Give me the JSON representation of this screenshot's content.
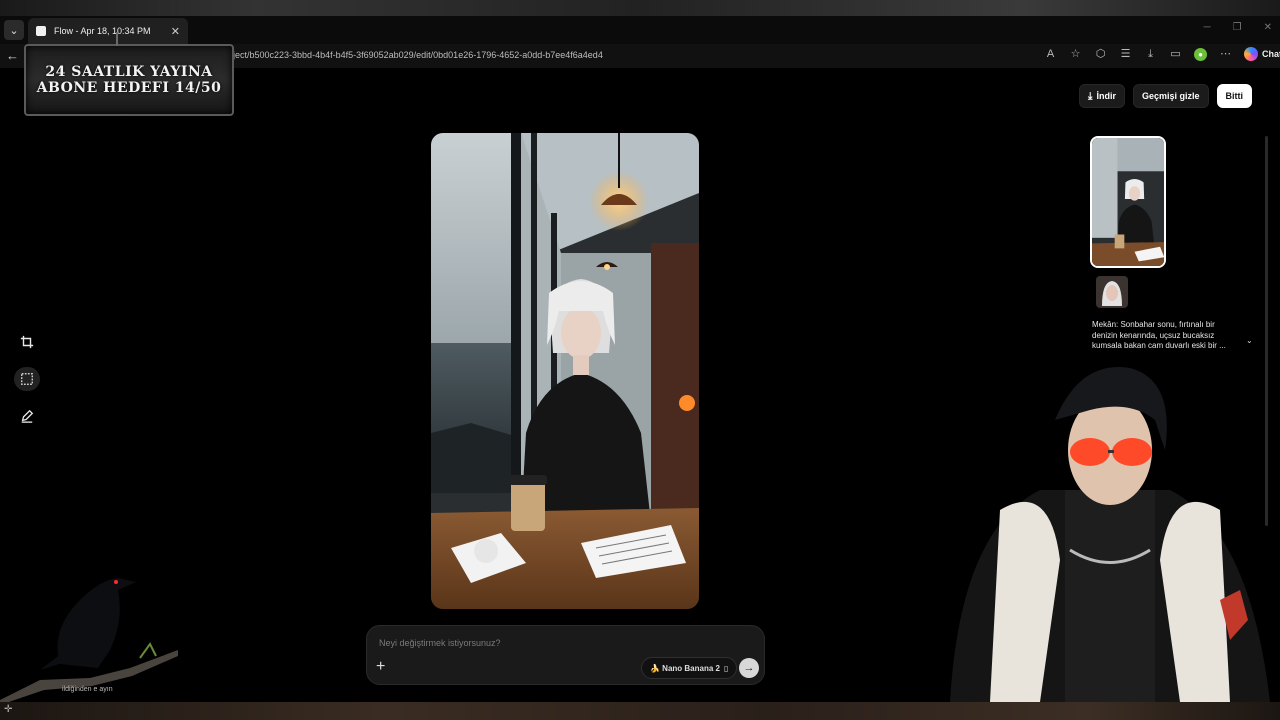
{
  "browser": {
    "tab_title": "Flow - Apr 18, 10:34 PM",
    "url": "oject/b500c223-3bbd-4b4f-b4f5-3f69052ab029/edit/0bd01e26-1796-4652-a0dd-b7ee4f6a4ed4",
    "copilot_label": "Chat"
  },
  "overlay": {
    "banner_line1": "24 SAATLIK YAYINA",
    "banner_line2": "ABONE HEDEFI 14/50",
    "bottom_caption": "ildiğinden e              ayın"
  },
  "toolbar": {
    "download_label": "İndir",
    "hide_history_label": "Geçmişi gizle",
    "done_label": "Bitti"
  },
  "tools": [
    {
      "icon": "crop-icon"
    },
    {
      "icon": "select-region-icon",
      "active": true
    },
    {
      "icon": "edit-pen-icon"
    }
  ],
  "prompt": {
    "placeholder": "Neyi değiştirmek istiyorsunuz?",
    "model_label": "🍌 Nano Banana 2",
    "model_suffix": "▯"
  },
  "history": {
    "description": "Mekân: Sonbahar sonu, fırtınalı bir denizin kenarında, uçsuz bucaksız kumsala bakan cam duvarlı eski bir ..."
  },
  "colors": {
    "background": "#000000",
    "panel": "#1a1a1a",
    "primary_button": "#ffffff"
  }
}
